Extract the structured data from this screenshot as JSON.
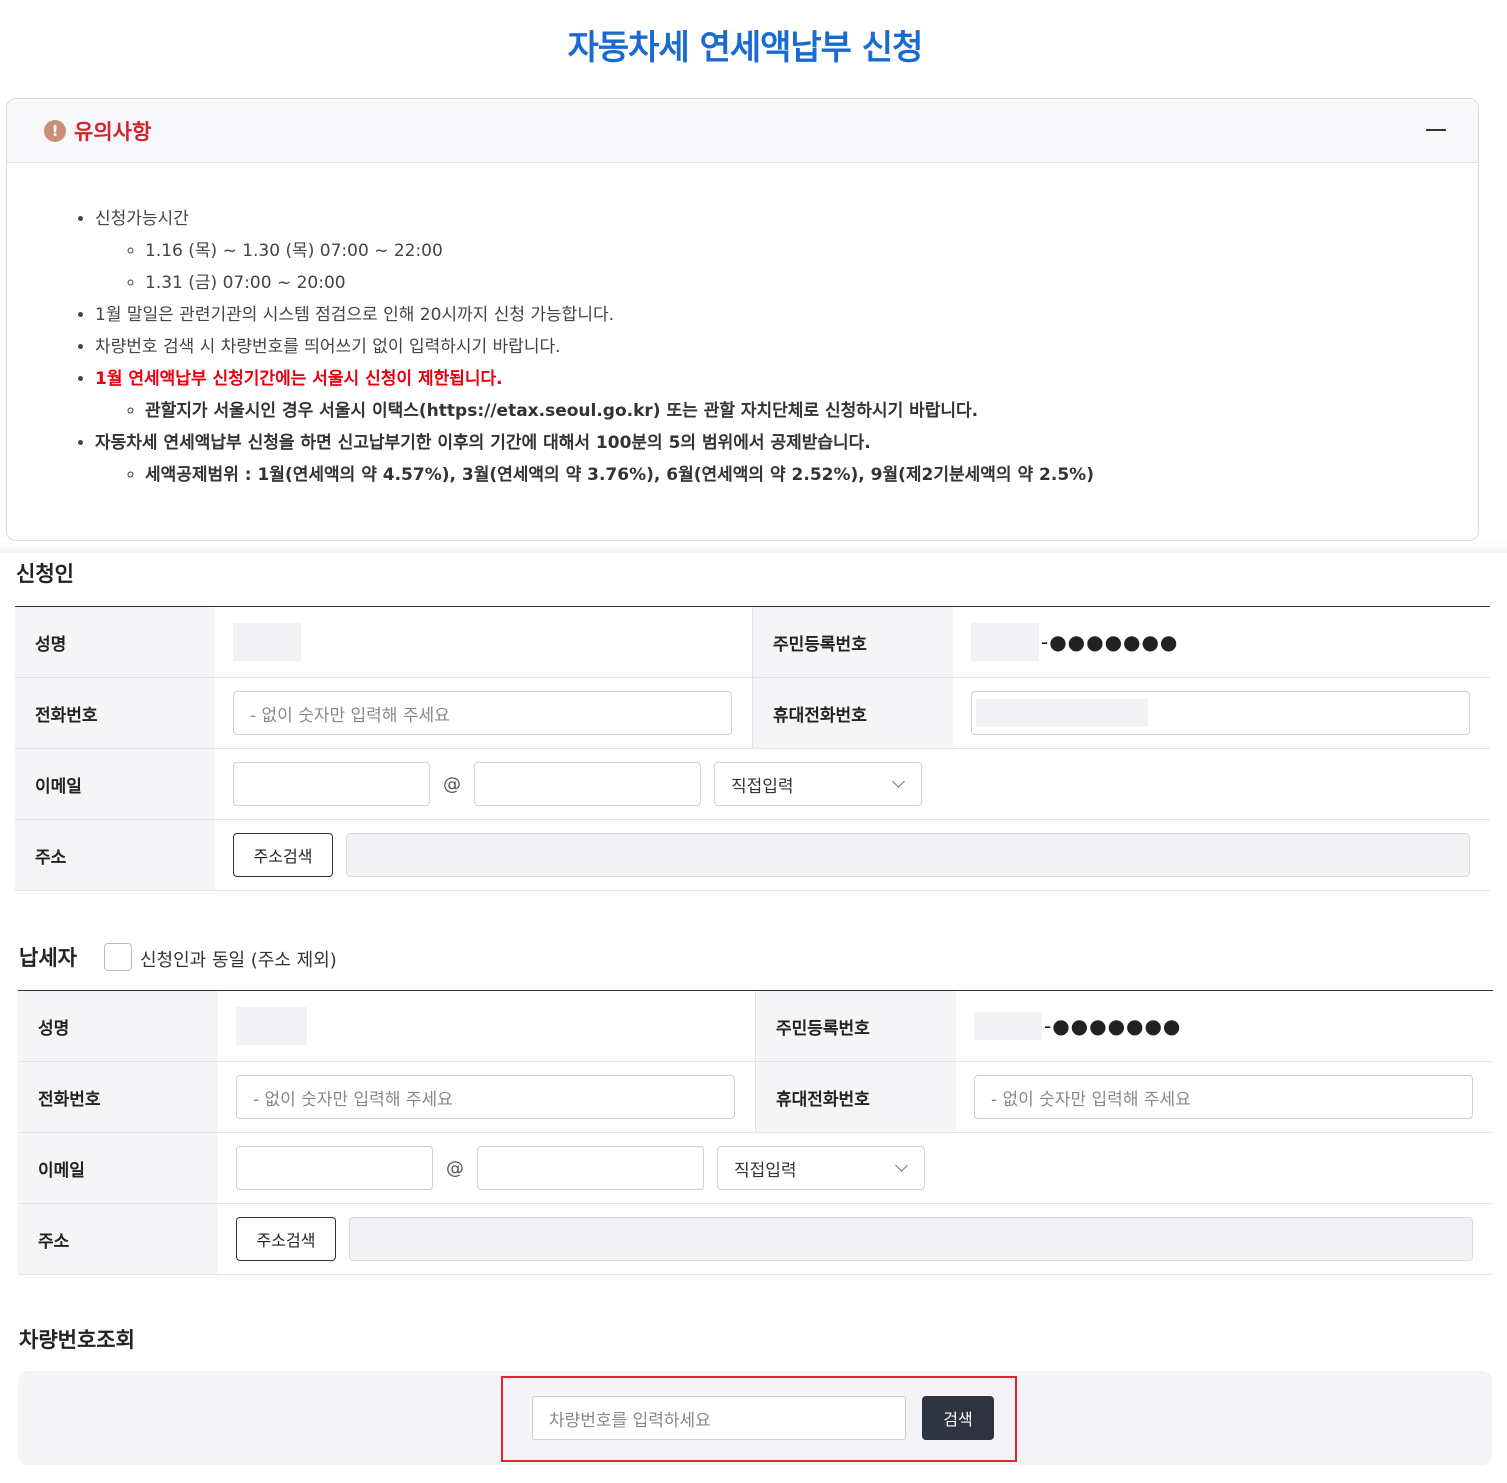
{
  "title": "자동차세 연세액납부 신청",
  "notice": {
    "icon": "exclamation-icon",
    "heading": "유의사항",
    "items": {
      "time_title": "신청가능시간",
      "time_1": "1.16 (목) ~ 1.30 (목) 07:00 ~ 22:00",
      "time_2": "1.31 (금) 07:00 ~ 20:00",
      "item_2": "1월 말일은 관련기관의 시스템 점검으로 인해 20시까지 신청 가능합니다.",
      "item_3": "차량번호 검색 시 차량번호를 띄어쓰기 없이 입력하시기 바랍니다.",
      "item_4": "1월 연세액납부 신청기간에는 서울시 신청이 제한됩니다.",
      "item_4_sub": "관할지가 서울시인 경우 서울시 이택스(https://etax.seoul.go.kr) 또는 관할 자치단체로 신청하시기 바랍니다.",
      "item_5": "자동차세 연세액납부 신청을 하면 신고납부기한 이후의 기간에 대해서 100분의 5의 범위에서 공제받습니다.",
      "item_5_sub": "세액공제범위 : 1월(연세액의 약 4.57%), 3월(연세액의 약 3.76%), 6월(연세액의 약 2.52%), 9월(제2기분세액의 약 2.5%)"
    }
  },
  "applicant": {
    "section_title": "신청인",
    "labels": {
      "name": "성명",
      "rrn": "주민등록번호",
      "phone": "전화번호",
      "mobile": "휴대전화번호",
      "email": "이메일",
      "address": "주소"
    },
    "rrn_mask": "-●●●●●●●",
    "phone_placeholder": "- 없이 숫자만 입력해 주세요",
    "at_sign": "@",
    "email_domain_select": "직접입력",
    "address_button": "주소검색"
  },
  "taxpayer": {
    "section_title": "납세자",
    "same_as_applicant": "신청인과 동일 (주소 제외)",
    "labels": {
      "name": "성명",
      "rrn": "주민등록번호",
      "phone": "전화번호",
      "mobile": "휴대전화번호",
      "email": "이메일",
      "address": "주소"
    },
    "rrn_mask": "-●●●●●●●",
    "phone_placeholder": "- 없이 숫자만 입력해 주세요",
    "mobile_placeholder": "- 없이 숫자만 입력해 주세요",
    "at_sign": "@",
    "email_domain_select": "직접입력",
    "address_button": "주소검색"
  },
  "vehicle": {
    "section_title": "차량번호조회",
    "placeholder": "차량번호를 입력하세요",
    "search_button": "검색"
  },
  "colors": {
    "title_blue": "#1a6bd0",
    "notice_red": "#d2232a",
    "warning_red": "#e8000f",
    "button_dark": "#2f3440"
  }
}
